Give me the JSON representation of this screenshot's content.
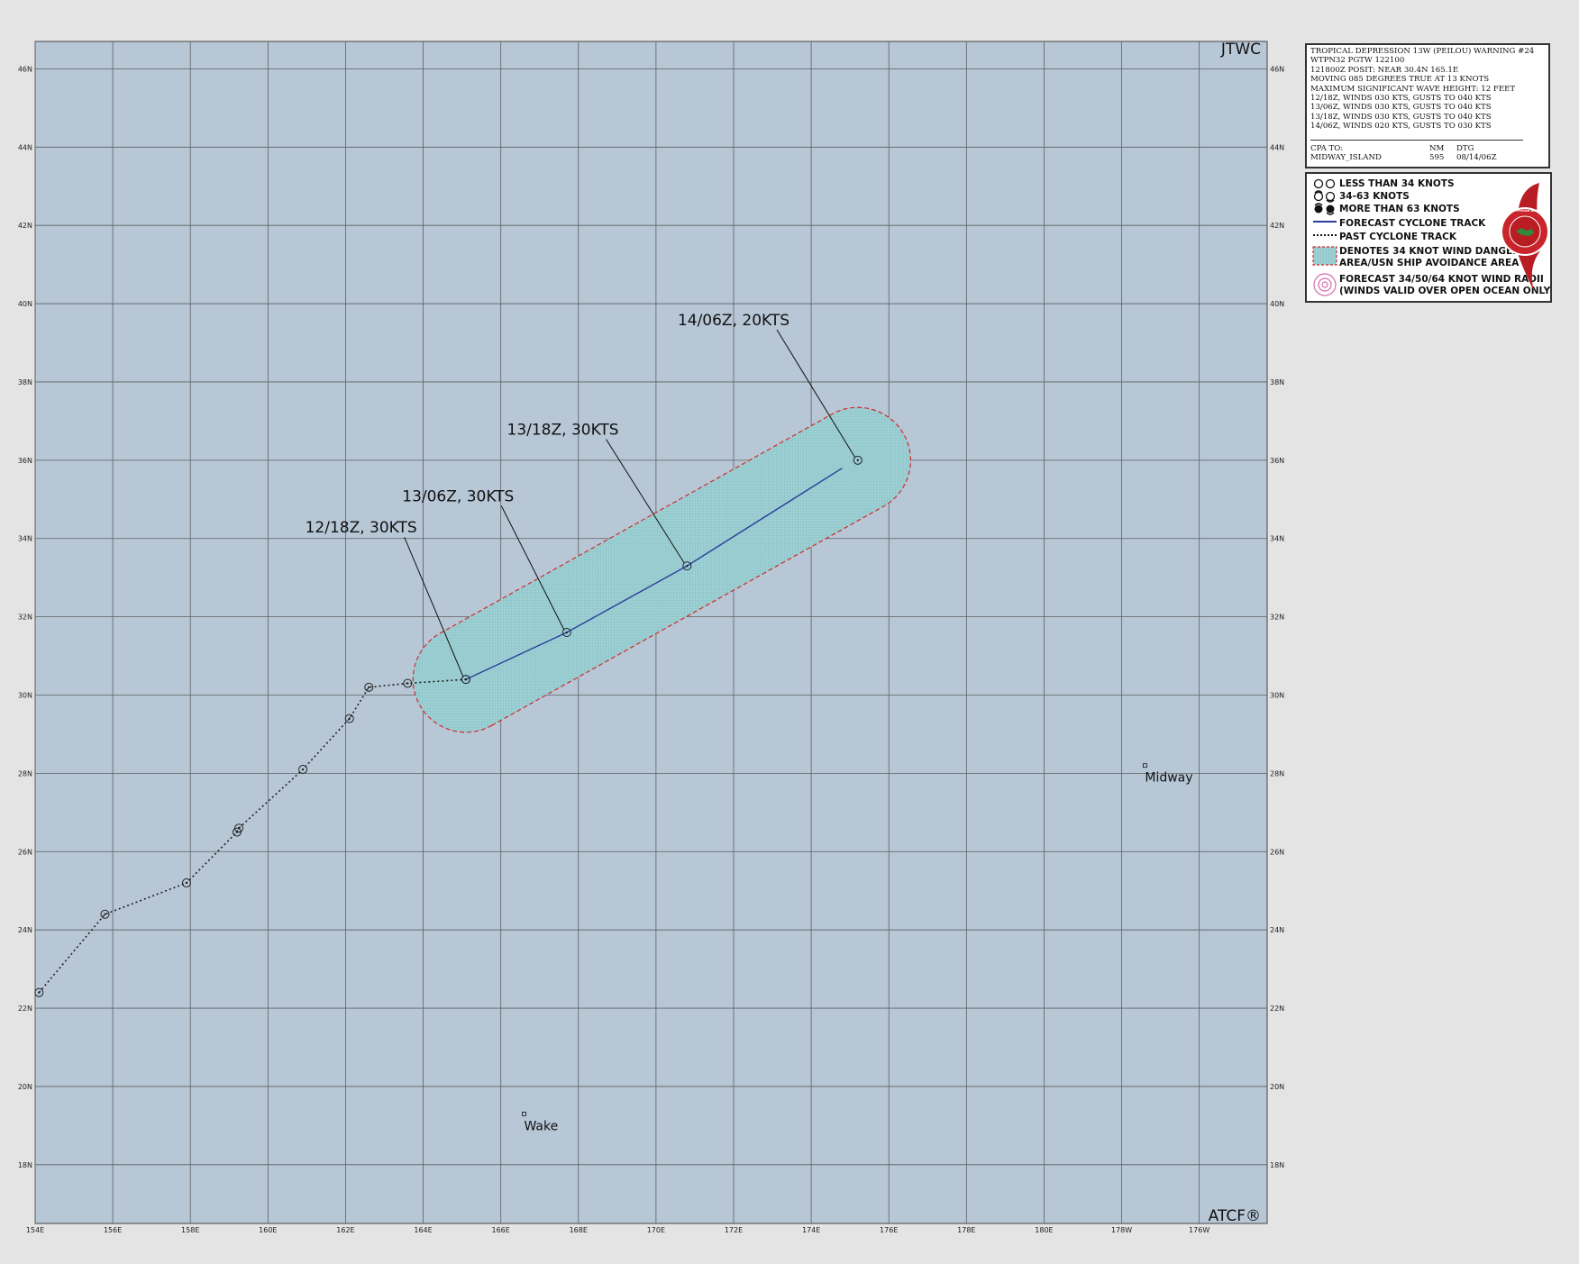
{
  "map": {
    "corner_top_right": "JTWC",
    "corner_bottom_right": "ATCF®",
    "lon_labels": [
      "154E",
      "156E",
      "158E",
      "160E",
      "162E",
      "164E",
      "166E",
      "168E",
      "170E",
      "172E",
      "174E",
      "176E",
      "178E",
      "180E",
      "178W",
      "176W"
    ],
    "lat_labels": [
      "46N",
      "44N",
      "42N",
      "40N",
      "38N",
      "36N",
      "34N",
      "32N",
      "30N",
      "28N",
      "26N",
      "24N",
      "22N",
      "20N",
      "18N"
    ],
    "dateline_color": "#8B5A2B",
    "ocean_color": "#b7c7d6"
  },
  "chart_data": {
    "type": "map",
    "lon_range": [
      154,
      185.75
    ],
    "lat_range": [
      16.5,
      46.7
    ],
    "past_track": [
      {
        "lon": 154.1,
        "lat": 22.4
      },
      {
        "lon": 155.8,
        "lat": 24.4
      },
      {
        "lon": 157.9,
        "lat": 25.2
      },
      {
        "lon": 159.2,
        "lat": 26.5
      },
      {
        "lon": 159.25,
        "lat": 26.6
      },
      {
        "lon": 160.9,
        "lat": 28.1
      },
      {
        "lon": 162.1,
        "lat": 29.4
      },
      {
        "lon": 162.6,
        "lat": 30.2
      },
      {
        "lon": 163.6,
        "lat": 30.3
      },
      {
        "lon": 165.1,
        "lat": 30.4
      }
    ],
    "forecast_track": [
      {
        "lon": 165.1,
        "lat": 30.4
      },
      {
        "lon": 167.7,
        "lat": 31.6
      },
      {
        "lon": 170.8,
        "lat": 33.3
      },
      {
        "lon": 174.8,
        "lat": 35.8
      }
    ],
    "forecast_points": [
      {
        "lon": 165.1,
        "lat": 30.4,
        "label": "12/18Z,  30KTS",
        "label_lon": 162.4,
        "label_lat": 34.15
      },
      {
        "lon": 167.7,
        "lat": 31.6,
        "label": "13/06Z,  30KTS",
        "label_lon": 164.9,
        "label_lat": 34.95
      },
      {
        "lon": 170.8,
        "lat": 33.3,
        "label": "13/18Z,  30KTS",
        "label_lon": 167.6,
        "label_lat": 36.65
      },
      {
        "lon": 175.2,
        "lat": 36.0,
        "label": "14/06Z,  20KTS",
        "label_lon": 172.0,
        "label_lat": 39.45
      }
    ],
    "danger_area_axis": [
      {
        "lon": 165.1,
        "lat": 30.4
      },
      {
        "lon": 175.2,
        "lat": 36.0
      }
    ],
    "danger_area_radius_deg": 1.35,
    "places": [
      {
        "name": "Wake",
        "lon": 166.6,
        "lat": 19.3
      },
      {
        "name": "Midway",
        "lon": 182.6,
        "lat": 28.2
      }
    ],
    "colors": {
      "forecast_track": "#2b3f9a",
      "past_track": "#222222",
      "danger_fill": "#9ed0d4",
      "danger_outline": "#d22b2b"
    }
  },
  "info": {
    "lines": [
      "TROPICAL DEPRESSION 13W (PEILOU) WARNING #24",
      "WTPN32 PGTW 122100",
      "121800Z POSIT: NEAR 30.4N 165.1E",
      "MOVING 085 DEGREES TRUE AT 13 KNOTS",
      "MAXIMUM SIGNIFICANT WAVE HEIGHT: 12 FEET",
      "12/18Z, WINDS 030 KTS, GUSTS TO 040 KTS",
      "13/06Z, WINDS 030 KTS, GUSTS TO 040 KTS",
      "13/18Z, WINDS 030 KTS, GUSTS TO 040 KTS",
      "14/06Z, WINDS 020 KTS, GUSTS TO 030 KTS"
    ],
    "cpa_header": [
      "CPA TO:",
      "NM",
      "DTG"
    ],
    "cpa_row": [
      "MIDWAY_ISLAND",
      "595",
      "08/14/06Z"
    ]
  },
  "legend": {
    "items": [
      "LESS THAN 34 KNOTS",
      "34-63 KNOTS",
      "MORE THAN 63 KNOTS",
      "FORECAST CYCLONE TRACK",
      "PAST CYCLONE TRACK",
      "DENOTES 34 KNOT WIND DANGER",
      "AREA/USN SHIP AVOIDANCE AREA",
      "FORECAST 34/50/64 KNOT WIND RADII",
      "(WINDS VALID OVER OPEN OCEAN ONLY)"
    ],
    "seal_text": "JOINT TYPHOON WARNING CENTER"
  }
}
